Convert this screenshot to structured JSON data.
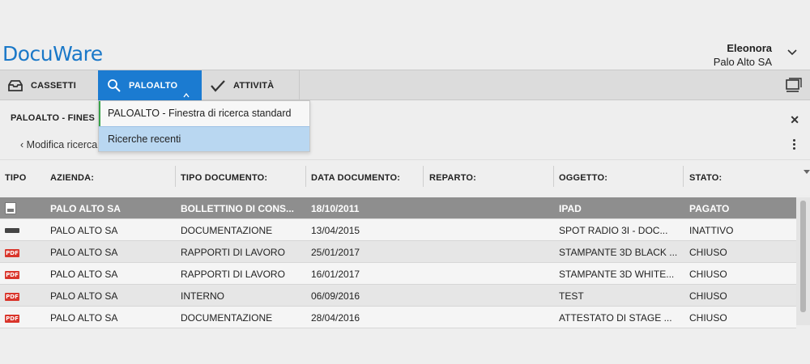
{
  "header": {
    "logo": "DocuWare",
    "user_name": "Eleonora",
    "user_company": "Palo Alto SA"
  },
  "toolbar": {
    "tabs": [
      {
        "label": "CASSETTI",
        "icon": "tray-icon"
      },
      {
        "label": "PALOALTO",
        "icon": "search-icon",
        "active": true
      },
      {
        "label": "ATTIVITÀ",
        "icon": "checkmark-icon"
      }
    ]
  },
  "dropdown": {
    "items": [
      {
        "label": "PALOALTO - Finestra di ricerca standard"
      },
      {
        "label": "Ricerche recenti",
        "highlighted": true
      }
    ]
  },
  "subheader": {
    "title": "PALOALTO - FINES",
    "back_label": "Modifica ricerca"
  },
  "table": {
    "columns": [
      "TIPO",
      "AZIENDA:",
      "TIPO DOCUMENTO:",
      "DATA DOCUMENTO:",
      "REPARTO:",
      "OGGETTO:",
      "STATO:"
    ],
    "rows": [
      {
        "type_icon": "document-icon",
        "azienda": "PALO ALTO SA",
        "tipo_documento": "BOLLETTINO DI CONS...",
        "data": "18/10/2011",
        "reparto": "",
        "oggetto": "IPAD",
        "stato": "PAGATO",
        "selected": true
      },
      {
        "type_icon": "keyboard-icon",
        "azienda": "PALO ALTO SA",
        "tipo_documento": "DOCUMENTAZIONE",
        "data": "13/04/2015",
        "reparto": "",
        "oggetto": "SPOT RADIO 3I - DOC...",
        "stato": "INATTIVO"
      },
      {
        "type_icon": "pdf-icon",
        "azienda": "PALO ALTO SA",
        "tipo_documento": "RAPPORTI DI LAVORO",
        "data": "25/01/2017",
        "reparto": "",
        "oggetto": "STAMPANTE 3D BLACK ...",
        "stato": "CHIUSO"
      },
      {
        "type_icon": "pdf-icon",
        "azienda": "PALO ALTO SA",
        "tipo_documento": "RAPPORTI DI LAVORO",
        "data": "16/01/2017",
        "reparto": "",
        "oggetto": "STAMPANTE 3D WHITE...",
        "stato": "CHIUSO"
      },
      {
        "type_icon": "pdf-icon",
        "azienda": "PALO ALTO SA",
        "tipo_documento": "INTERNO",
        "data": "06/09/2016",
        "reparto": "",
        "oggetto": "TEST",
        "stato": "CHIUSO"
      },
      {
        "type_icon": "pdf-icon",
        "azienda": "PALO ALTO SA",
        "tipo_documento": "DOCUMENTAZIONE",
        "data": "28/04/2016",
        "reparto": "",
        "oggetto": "ATTESTATO DI STAGE ...",
        "stato": "CHIUSO"
      }
    ]
  },
  "icons": {
    "pdf_label": "PDF",
    "close": "✕"
  },
  "colors": {
    "accent": "#1b7bd1",
    "logo": "#1a78c8",
    "selected_row": "#8e8e8e",
    "dropdown_highlight": "#b9d7f1",
    "pdf": "#d9352b"
  }
}
